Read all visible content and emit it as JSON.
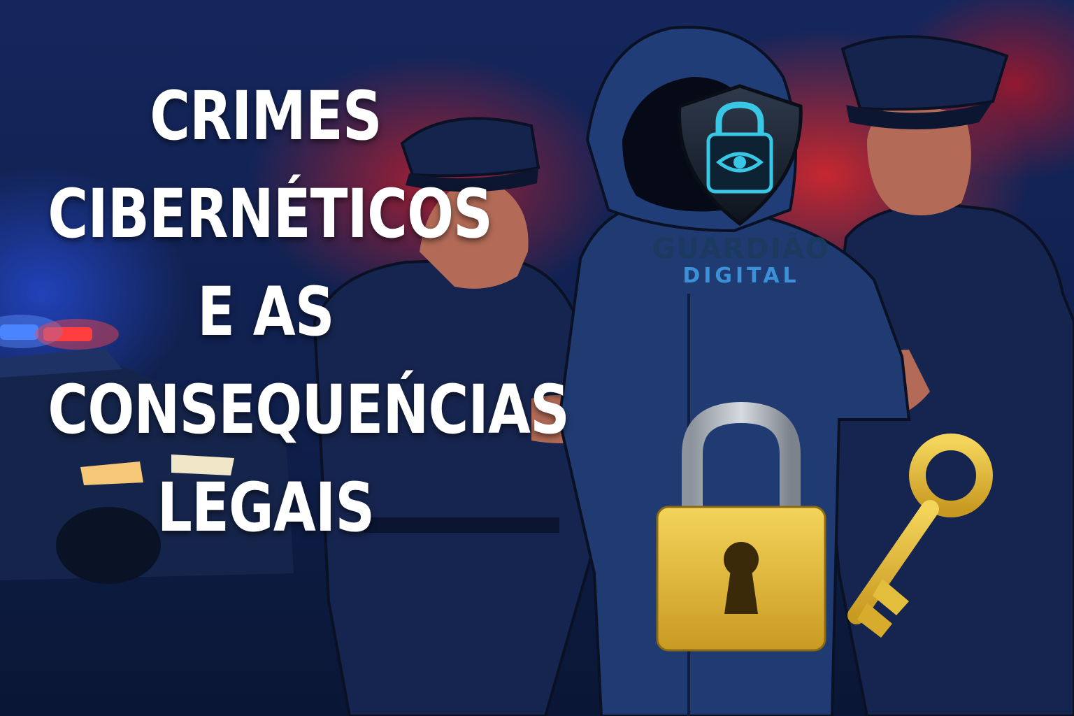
{
  "headline": {
    "line1": "CRIMES",
    "line2": "CIBERNÉTICOS",
    "line3": "E AS",
    "line4": "CONSEQUEŃCIAS",
    "line5": "LEGAIS"
  },
  "brand": {
    "name_top": "GUARDIÃO",
    "name_bottom": "DIGITAL",
    "icon": "shield-padlock-eye-icon"
  },
  "icons": [
    "padlock-icon",
    "key-icon",
    "police-car-icon"
  ],
  "colors": {
    "background_blue": "#14265c",
    "background_red": "#e62828",
    "uniform_navy": "#15244d",
    "hoodie_blue": "#1f3b72",
    "gold": "#e3bd3c",
    "text_white": "#ffffff",
    "brand_blue": "#3b90d8"
  }
}
